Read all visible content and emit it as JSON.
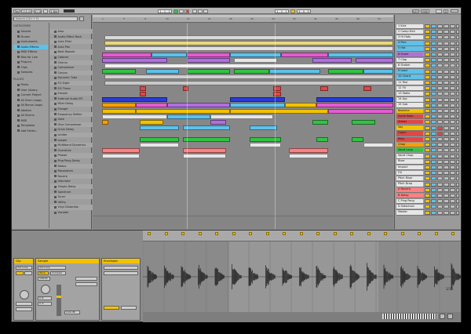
{
  "transport": {
    "tap": "Tap",
    "tempo": "128.00",
    "time_sig": "4 / 4",
    "bar": "1 Bar",
    "position": "1 . 1 . 1",
    "loop_start": "1 . 1 . 1",
    "loop_len": "4 . 0 . 0",
    "key": "KEY",
    "midi": "MIDI",
    "cpu": "D"
  },
  "browser": {
    "search_placeholder": "Search (Ctrl + F)",
    "collections_header": "CATEGORIES",
    "categories": [
      "Sounds",
      "Drums",
      "Instruments",
      "Audio Effects",
      "MIDI Effects",
      "Max for Live",
      "Plug-ins",
      "Clips",
      "Samples"
    ],
    "selected_category": "Audio Effects",
    "places_header": "PLACES",
    "places": [
      "Packs",
      "User Library",
      "Current Project",
      "All Drum Loops",
      "All Bonus Loops",
      "Ableton",
      "All Drums",
      "MIDI",
      "Templates",
      "Add Folder..."
    ],
    "items": [
      "Amp",
      "Audio Effect Rack",
      "Auto Filter",
      "Auto Pan",
      "Beat Repeat",
      "Cabinet",
      "Chorus",
      "Compressor",
      "Corpus",
      "Dynamic Tube",
      "EQ Eight",
      "EQ Three",
      "Erosion",
      "External Audio Eff.",
      "Filter Delay",
      "Flanger",
      "Frequency Shifter",
      "Gate",
      "Glue Compressor",
      "Grain Delay",
      "Limiter",
      "Looper",
      "Multiband Dynamics",
      "Overdrive",
      "Phaser",
      "Ping Pong Delay",
      "Redux",
      "Resonators",
      "Reverb",
      "Saturator",
      "Simple Delay",
      "Spectrum",
      "Tuner",
      "Utility",
      "Vinyl Distortion",
      "Vocoder"
    ]
  },
  "arrangement": {
    "ruler_ticks": [
      "1",
      "5",
      "9",
      "13",
      "17",
      "21",
      "25",
      "29",
      "33",
      "37",
      "41",
      "45",
      "49",
      "53"
    ]
  },
  "mixer": {
    "tracks": [
      {
        "name": "1 Kick",
        "color": "#e6e6e6"
      },
      {
        "name": "2 Comp Kick",
        "color": "#e6e6e6"
      },
      {
        "name": "3 Hi Hats",
        "color": "#e6e6e6"
      },
      {
        "name": "4 Perc",
        "color": "#5fc0e8"
      },
      {
        "name": "5 Hat",
        "color": "#5fc0e8"
      },
      {
        "name": "6 Snare",
        "color": "#b06fe0"
      },
      {
        "name": "7 Clap",
        "color": "#e6e6e6"
      },
      {
        "name": "8 Shaker",
        "color": "#e6e6e6"
      },
      {
        "name": "9 Lead",
        "color": "#5fc0e8"
      },
      {
        "name": "10 Chord",
        "color": "#5fc0e8"
      },
      {
        "name": "11 Pad",
        "color": "#e6e6e6"
      },
      {
        "name": "12 FX",
        "color": "#e6e6e6"
      },
      {
        "name": "13 Stabs",
        "color": "#e6e6e6"
      },
      {
        "name": "14 Arp",
        "color": "#e6e6e6"
      },
      {
        "name": "15 Sub",
        "color": "#e6e6e6"
      },
      {
        "name": "Bassline",
        "color": "#f2c200"
      },
      {
        "name": "Synth Bass",
        "color": "#e04747"
      },
      {
        "name": "Atmos",
        "color": "#e04747"
      },
      {
        "name": "Vox",
        "color": "#f2c200"
      },
      {
        "name": "Organ",
        "color": "#e04747"
      },
      {
        "name": "Keys",
        "color": "#e04747"
      },
      {
        "name": "Chop",
        "color": "#f5a000"
      },
      {
        "name": "Vocal Loop",
        "color": "#34c246"
      },
      {
        "name": "Vocal Chop",
        "color": "#e6e6e6"
      },
      {
        "name": "Riser",
        "color": "#e6e6e6"
      },
      {
        "name": "Impact",
        "color": "#e6e6e6"
      },
      {
        "name": "Fill",
        "color": "#e6e6e6"
      },
      {
        "name": "Pitch Riser",
        "color": "#e6e6e6"
      },
      {
        "name": "Pitch Drop",
        "color": "#e6e6e6"
      },
      {
        "name": "A Reverb",
        "color": "#ff8080"
      },
      {
        "name": "B Delay",
        "color": "#ff8080"
      },
      {
        "name": "C Ping Pong",
        "color": "#e6e6e6"
      },
      {
        "name": "D Sidechain",
        "color": "#e6e6e6"
      },
      {
        "name": "Master",
        "color": "#e6e6e6"
      }
    ]
  },
  "clip_view": {
    "clip_title": "Clip",
    "sample_title": "Sample",
    "envelopes_title": "Envelopes",
    "sample_name": "Vox Loop",
    "warp_label": "Warp",
    "mode_label": "Complex",
    "transpose": "0 st",
    "detune": "0 ct",
    "gain": "0.00 dB",
    "bpm": "128.00",
    "page": "1/16"
  },
  "colors": {
    "accent": "#f2c200",
    "selection": "#5fc0e8"
  }
}
